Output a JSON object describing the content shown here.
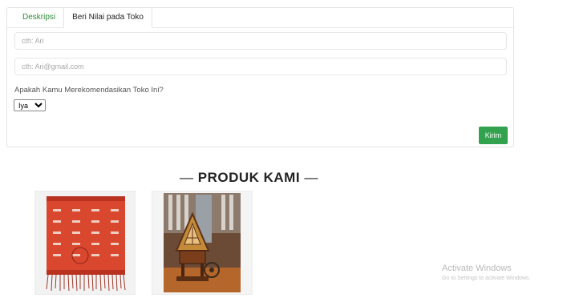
{
  "tabs": [
    {
      "label": "Deskripsi"
    },
    {
      "label": "Beri Nilai pada Toko"
    }
  ],
  "form": {
    "name_placeholder": "cth: Ari",
    "email_placeholder": "cth: Ari@gmail.com",
    "question": "Apakah Kamu Merekomendasikan Toko Ini?",
    "recommend_selected": "Iya",
    "submit_label": "Kirim"
  },
  "section": {
    "title": "PRODUK KAMI",
    "dash": "—"
  },
  "products": [
    {
      "image": "red-ulos-textile-photo"
    },
    {
      "image": "batak-house-miniature-photo"
    }
  ],
  "watermark": {
    "title": "Activate Windows",
    "subtitle": "Go to Settings to activate Windows."
  },
  "colors": {
    "accent_green": "#33a24f",
    "tab_green": "#2e8b3a"
  }
}
